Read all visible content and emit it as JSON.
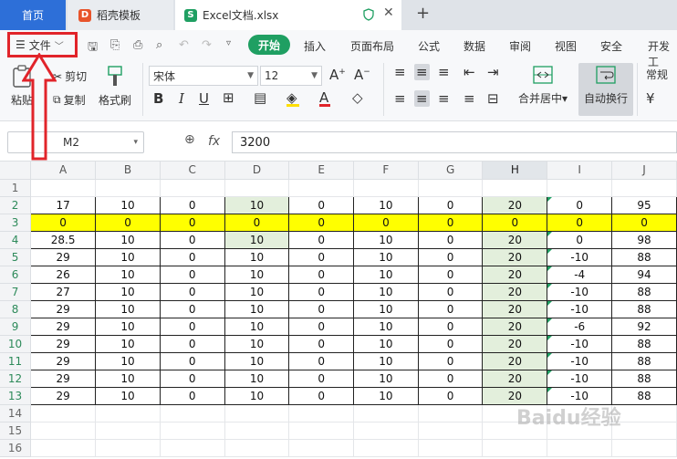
{
  "tabs": {
    "home": "首页",
    "daoke": "稻壳模板",
    "excel": "Excel文档.xlsx"
  },
  "menu": {
    "file": "文件",
    "active": "开始",
    "items": [
      "插入",
      "页面布局",
      "公式",
      "数据",
      "审阅",
      "视图",
      "安全",
      "开发工"
    ]
  },
  "toolbar": {
    "paste": "粘贴",
    "cut": "剪切",
    "copy": "复制",
    "format_painter": "格式刷",
    "font": "宋体",
    "size": "12",
    "merge": "合并居中",
    "wrap": "自动换行",
    "numfmt": "常规"
  },
  "formula_bar": {
    "cell": "M2",
    "fx": "fx",
    "value": "3200"
  },
  "grid": {
    "columns": [
      "A",
      "B",
      "C",
      "D",
      "E",
      "F",
      "G",
      "H",
      "I",
      "J"
    ],
    "rows": [
      {
        "n": "1",
        "cells": [
          "",
          "",
          "",
          "",
          "",
          "",
          "",
          "",
          "",
          ""
        ]
      },
      {
        "n": "2",
        "cells": [
          "17",
          "10",
          "0",
          "10",
          "0",
          "10",
          "0",
          "20",
          "0",
          "95"
        ]
      },
      {
        "n": "3",
        "cells": [
          "0",
          "0",
          "0",
          "0",
          "0",
          "0",
          "0",
          "0",
          "0",
          "0"
        ]
      },
      {
        "n": "4",
        "cells": [
          "28.5",
          "10",
          "0",
          "10",
          "0",
          "10",
          "0",
          "20",
          "0",
          "98"
        ]
      },
      {
        "n": "5",
        "cells": [
          "29",
          "10",
          "0",
          "10",
          "0",
          "10",
          "0",
          "20",
          "-10",
          "88"
        ]
      },
      {
        "n": "6",
        "cells": [
          "26",
          "10",
          "0",
          "10",
          "0",
          "10",
          "0",
          "20",
          "-4",
          "94"
        ]
      },
      {
        "n": "7",
        "cells": [
          "27",
          "10",
          "0",
          "10",
          "0",
          "10",
          "0",
          "20",
          "-10",
          "88"
        ]
      },
      {
        "n": "8",
        "cells": [
          "29",
          "10",
          "0",
          "10",
          "0",
          "10",
          "0",
          "20",
          "-10",
          "88"
        ]
      },
      {
        "n": "9",
        "cells": [
          "29",
          "10",
          "0",
          "10",
          "0",
          "10",
          "0",
          "20",
          "-6",
          "92"
        ]
      },
      {
        "n": "10",
        "cells": [
          "29",
          "10",
          "0",
          "10",
          "0",
          "10",
          "0",
          "20",
          "-10",
          "88"
        ]
      },
      {
        "n": "11",
        "cells": [
          "29",
          "10",
          "0",
          "10",
          "0",
          "10",
          "0",
          "20",
          "-10",
          "88"
        ]
      },
      {
        "n": "12",
        "cells": [
          "29",
          "10",
          "0",
          "10",
          "0",
          "10",
          "0",
          "20",
          "-10",
          "88"
        ]
      },
      {
        "n": "13",
        "cells": [
          "29",
          "10",
          "0",
          "10",
          "0",
          "10",
          "0",
          "20",
          "-10",
          "88"
        ]
      },
      {
        "n": "14",
        "cells": [
          "",
          "",
          "",
          "",
          "",
          "",
          "",
          "",
          "",
          ""
        ]
      },
      {
        "n": "15",
        "cells": [
          "",
          "",
          "",
          "",
          "",
          "",
          "",
          "",
          "",
          ""
        ]
      },
      {
        "n": "16",
        "cells": [
          "",
          "",
          "",
          "",
          "",
          "",
          "",
          "",
          "",
          ""
        ]
      }
    ]
  },
  "watermark": "Baidu经验",
  "colors": {
    "tab_home": "#2d6fd8",
    "accent_green": "#1f9f62",
    "highlight_yellow": "#ffff00",
    "annotation_red": "#e1242a"
  }
}
